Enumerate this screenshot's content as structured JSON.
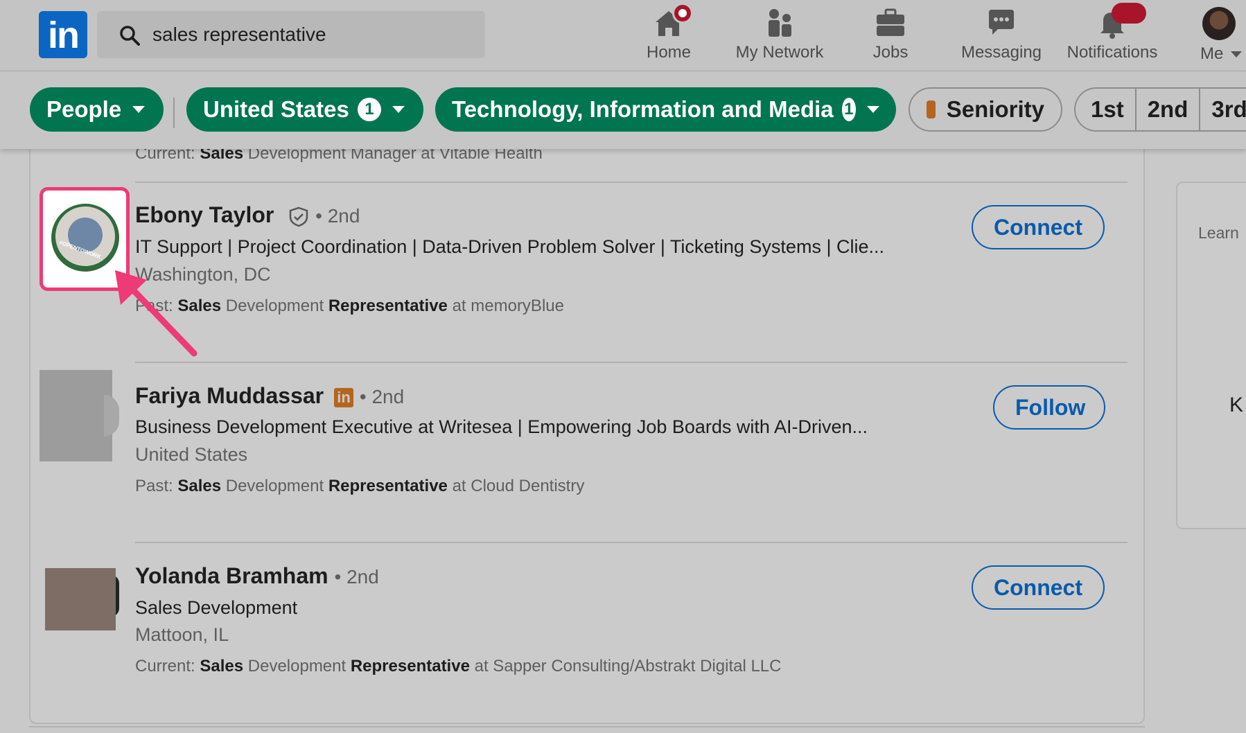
{
  "nav": {
    "search_value": "sales representative",
    "items": [
      {
        "label": "Home"
      },
      {
        "label": "My Network"
      },
      {
        "label": "Jobs"
      },
      {
        "label": "Messaging"
      },
      {
        "label": "Notifications"
      },
      {
        "label": "Me"
      }
    ],
    "logo_text": "in"
  },
  "filters": {
    "people": "People",
    "country": "United States",
    "country_count": "1",
    "industry": "Technology, Information and Media",
    "industry_count": "1",
    "seniority": "Seniority",
    "degrees": [
      "1st",
      "2nd",
      "3rd+"
    ]
  },
  "results": {
    "prev_line": {
      "prefix": "Current: ",
      "b1": "Sales",
      "rest": " Development Manager at Vitable Health"
    },
    "people": [
      {
        "name": "Ebony Taylor",
        "degree": "• 2nd",
        "headline": "IT Support | Project Coordination | Data-Driven Problem Solver | Ticketing Systems | Clie...",
        "location": "Washington, DC",
        "detail_prefix": "Past: ",
        "detail_b1": "Sales",
        "detail_mid": " Development ",
        "detail_b2": "Representative",
        "detail_rest": " at memoryBlue",
        "action": "Connect",
        "avatar_text": "#OPENTOWORK"
      },
      {
        "name": "Fariya Muddassar",
        "degree": "• 2nd",
        "headline": "Business Development Executive at Writesea | Empowering Job Boards with AI-Driven...",
        "location": "United States",
        "detail_prefix": "Past: ",
        "detail_b1": "Sales",
        "detail_mid": " Development ",
        "detail_b2": "Representative",
        "detail_rest": " at Cloud Dentistry",
        "action": "Follow"
      },
      {
        "name": "Yolanda Bramham",
        "degree": "• 2nd",
        "headline": "Sales Development",
        "location": "Mattoon, IL",
        "detail_prefix": "Current: ",
        "detail_b1": "Sales",
        "detail_mid": " Development ",
        "detail_b2": "Representative",
        "detail_rest": " at Sapper Consulting/Abstrakt Digital LLC",
        "action": "Connect"
      }
    ]
  },
  "side": {
    "learn": "Learn",
    "k": "K"
  },
  "colors": {
    "accent": "#0a66c2",
    "filter_green": "#01754f",
    "highlight": "#ee3a76"
  }
}
